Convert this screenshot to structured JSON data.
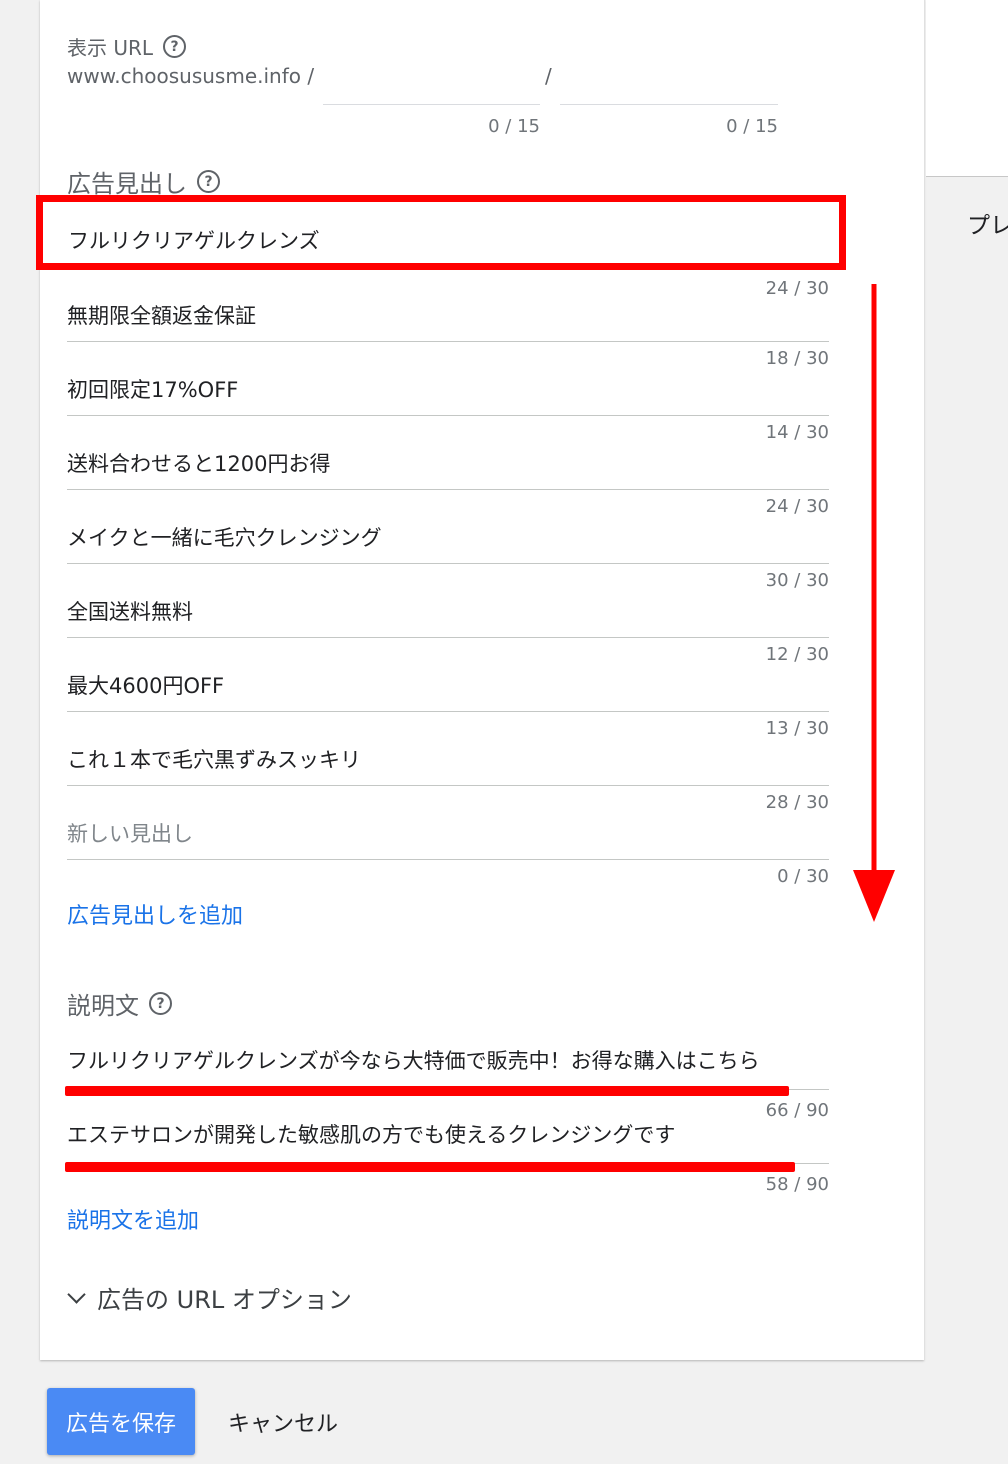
{
  "preview_label": "プレ",
  "display_url": {
    "label": "表示 URL",
    "domain": "www.choosususme.info /",
    "separator": "/",
    "path1": {
      "value": "",
      "counter": "0 / 15"
    },
    "path2": {
      "value": "",
      "counter": "0 / 15"
    }
  },
  "headlines": {
    "label": "広告見出し",
    "items": [
      {
        "value": "フルリクリアゲルクレンズ",
        "counter": "24 / 30"
      },
      {
        "value": "無期限全額返金保証",
        "counter": "18 / 30"
      },
      {
        "value": "初回限定17%OFF",
        "counter": "14 / 30"
      },
      {
        "value": "送料合わせると1200円お得",
        "counter": "24 / 30"
      },
      {
        "value": "メイクと一緒に毛穴クレンジング",
        "counter": "30 / 30"
      },
      {
        "value": "全国送料無料",
        "counter": "12 / 30"
      },
      {
        "value": "最大4600円OFF",
        "counter": "13 / 30"
      },
      {
        "value": "これ１本で毛穴黒ずみスッキリ",
        "counter": "28 / 30"
      }
    ],
    "new_placeholder": "新しい見出し",
    "new_counter": "0 / 30",
    "add_link": "広告見出しを追加"
  },
  "descriptions": {
    "label": "説明文",
    "items": [
      {
        "value": "フルリクリアゲルクレンズが今なら大特価で販売中！お得な購入はこちら",
        "counter": "66 / 90"
      },
      {
        "value": "エステサロンが開発した敏感肌の方でも使えるクレンジングです",
        "counter": "58 / 90"
      }
    ],
    "add_link": "説明文を追加"
  },
  "url_options_label": "広告の URL オプション",
  "actions": {
    "save": "広告を保存",
    "cancel": "キャンセル"
  },
  "colors": {
    "annotation": "#ff0000",
    "link": "#1a73e8",
    "primary_button": "#4a8af4"
  }
}
